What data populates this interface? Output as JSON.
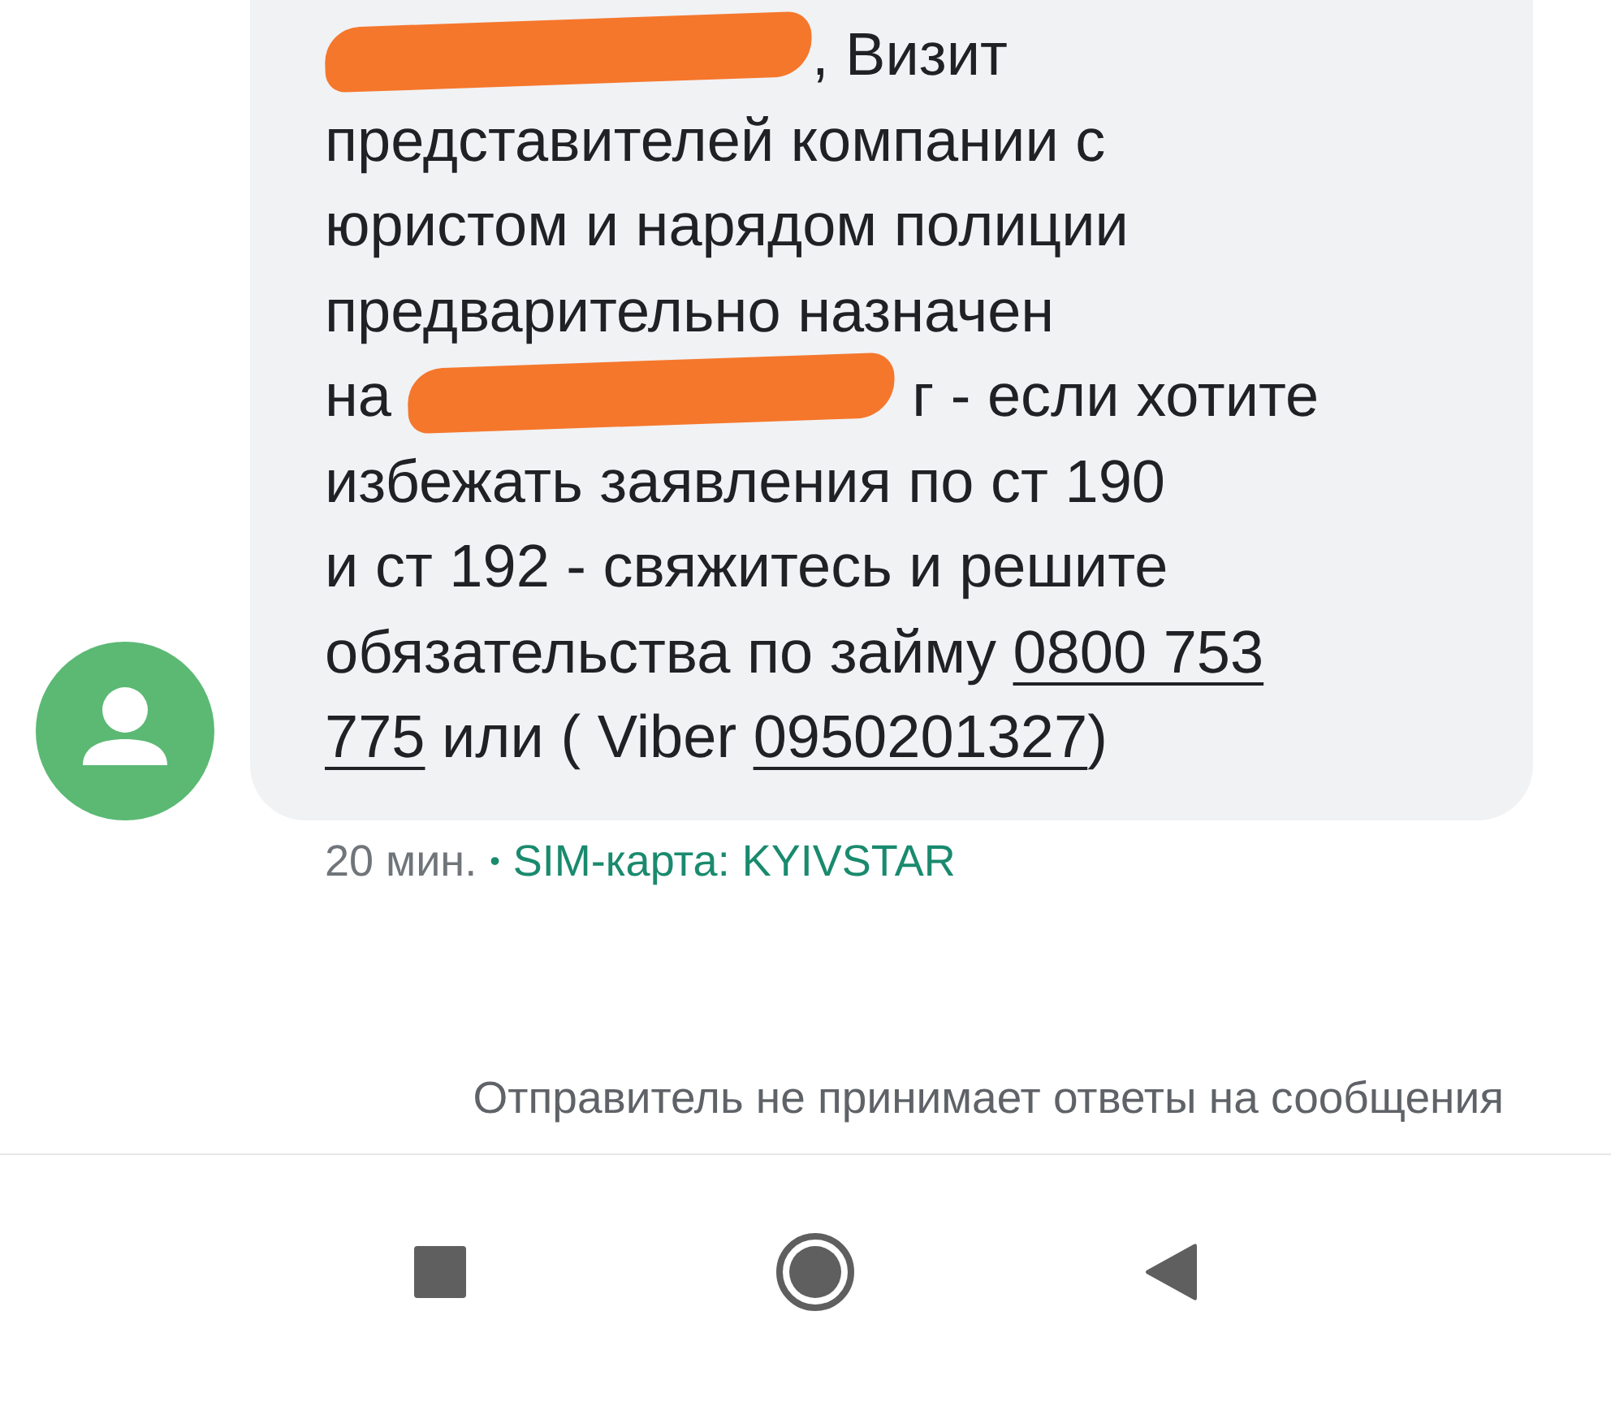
{
  "message": {
    "lines": [
      [
        {
          "kind": "redaction"
        },
        {
          "kind": "text",
          "text": ", Визит"
        }
      ],
      [
        {
          "kind": "text",
          "text": "представителей компании с"
        }
      ],
      [
        {
          "kind": "text",
          "text": "юристом и нарядом полиции"
        }
      ],
      [
        {
          "kind": "text",
          "text": "предварительно назначен"
        }
      ],
      [
        {
          "kind": "text",
          "text": "на "
        },
        {
          "kind": "redaction"
        },
        {
          "kind": "text",
          "text": " г - если хотите"
        }
      ],
      [
        {
          "kind": "text",
          "text": "избежать заявления по ст 190"
        }
      ],
      [
        {
          "kind": "text",
          "text": "и ст 192 - свяжитесь и решите"
        }
      ],
      [
        {
          "kind": "text",
          "text": "обязательства по займу "
        },
        {
          "kind": "link",
          "text": "0800 753"
        }
      ],
      [
        {
          "kind": "link",
          "text": "775"
        },
        {
          "kind": "text",
          "text": " или ( Viber "
        },
        {
          "kind": "link",
          "text": "0950201327"
        },
        {
          "kind": "text",
          "text": ")"
        }
      ]
    ],
    "time": "20 мин.",
    "separator": "•",
    "sim": "SIM-карта: KYIVSTAR"
  },
  "notice": "Отправитель не принимает ответы на сообщения"
}
